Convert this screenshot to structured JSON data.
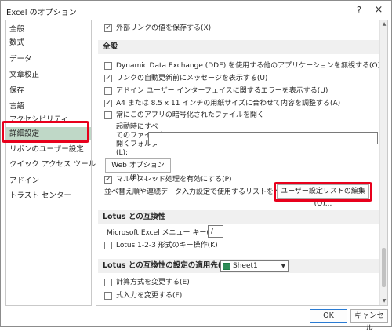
{
  "window": {
    "title": "Excel のオプション",
    "help": "?",
    "close": "×"
  },
  "sidebar": {
    "items": [
      {
        "label": "全般"
      },
      {
        "label": "数式"
      },
      {
        "label": "データ"
      },
      {
        "label": "文章校正"
      },
      {
        "label": "保存"
      },
      {
        "label": "言語"
      },
      {
        "label": "アクセシビリティ"
      },
      {
        "label": "詳細設定",
        "selected": true
      },
      {
        "label": "リボンのユーザー設定"
      },
      {
        "label": "クイック アクセス ツール バー"
      },
      {
        "label": "アドイン"
      },
      {
        "label": "トラスト センター"
      }
    ],
    "highlight_color": "#e8001c",
    "selected_bg": "#bfd8c7"
  },
  "main": {
    "top_check": {
      "label": "外部リンクの値を保存する(X)",
      "checked": true
    },
    "section_general": "全般",
    "general_checks": [
      {
        "label": "Dynamic Data Exchange (DDE) を使用する他のアプリケーションを無視する(O)",
        "checked": false
      },
      {
        "label": "リンクの自動更新前にメッセージを表示する(U)",
        "checked": true
      },
      {
        "label": "アドイン ユーザー インターフェイスに関するエラーを表示する(U)",
        "checked": false
      },
      {
        "label": "A4 または 8.5 x 11 インチの用紙サイズに合わせて内容を調整する(A)",
        "checked": true
      },
      {
        "label": "常にこのアプリの暗号化されたファイルを開く",
        "checked": false
      }
    ],
    "startup_label_1": "起動時にすべ",
    "startup_label_2": "てのファイルを",
    "startup_label_3": "開くフォルダー",
    "startup_label_4": "(L):",
    "startup_value": "",
    "web_options_button": "Web オプション(P)...",
    "multithread": {
      "label": "マルチスレッド処理を有効にする(P)",
      "checked": true
    },
    "custom_list_text": "並べ替え順や連続データ入力設定で使用するリストを作成します:",
    "custom_list_button": "ユーザー設定リストの編集(O)...",
    "section_lotus": "Lotus との互換性",
    "menu_key_label": "Microsoft Excel メニュー キー(M):",
    "menu_key_value": "/",
    "lotus_nav": {
      "label": "Lotus 1-2-3 形式のキー操作(K)",
      "checked": false
    },
    "section_lotus_settings": "Lotus との互換性の設定の適用先(L):",
    "sheet_select": "Sheet1",
    "lotus_settings_checks": [
      {
        "label": "計算方式を変更する(E)",
        "checked": false
      },
      {
        "label": "式入力を変更する(F)",
        "checked": false
      }
    ]
  },
  "footer": {
    "ok": "OK",
    "cancel": "キャンセル"
  }
}
